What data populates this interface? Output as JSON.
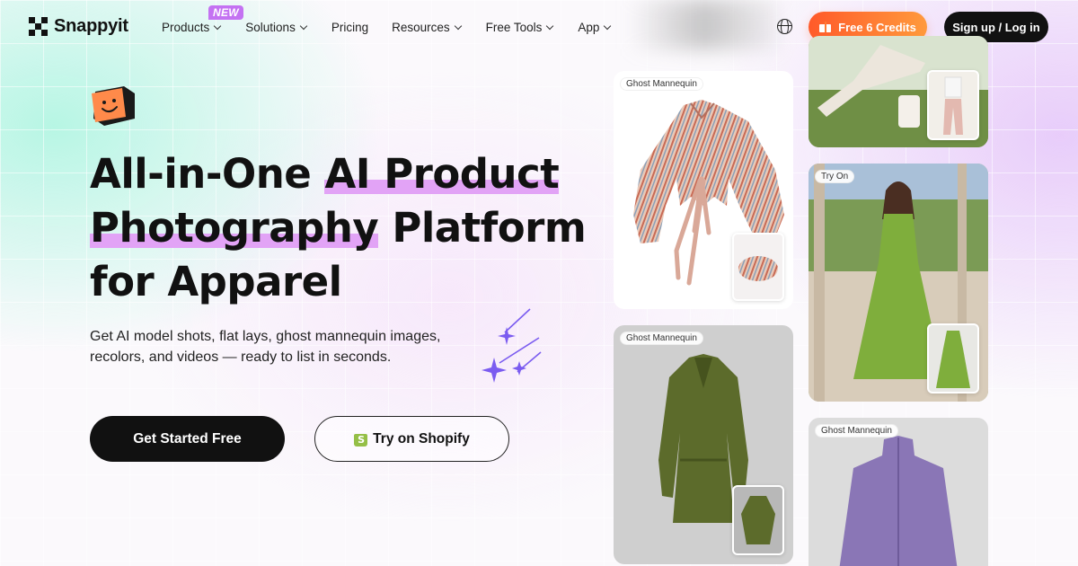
{
  "brand": {
    "name": "Snappyit"
  },
  "nav": {
    "items": [
      {
        "label": "Products",
        "has_dropdown": true,
        "badge": "NEW"
      },
      {
        "label": "Solutions",
        "has_dropdown": true
      },
      {
        "label": "Pricing",
        "has_dropdown": false
      },
      {
        "label": "Resources",
        "has_dropdown": true
      },
      {
        "label": "Free Tools",
        "has_dropdown": true
      },
      {
        "label": "App",
        "has_dropdown": true
      }
    ],
    "credits_button": "Free 6 Credits",
    "signup_button": "Sign up / Log in"
  },
  "hero": {
    "headline": {
      "line1_plain": "All-in-One ",
      "line1_highlight": "AI Product",
      "line2_highlight": "Photography",
      "line2_plain": " Platform",
      "line3": "for Apparel"
    },
    "subtext": "Get AI model shots, flat lays, ghost mannequin images, recolors, and videos — ready to list in seconds.",
    "cta_primary": "Get Started Free",
    "cta_secondary": "Try on Shopify"
  },
  "gallery": {
    "cards": [
      {
        "tag": "Ghost Mannequin",
        "subject": "striped puff-sleeve blouse"
      },
      {
        "tag": "Ghost Mannequin",
        "subject": "green velvet dress"
      },
      {
        "tag": "",
        "subject": "model in white trousers on lawn"
      },
      {
        "tag": "Try On",
        "subject": "model in green maxi dress"
      },
      {
        "tag": "Ghost Mannequin",
        "subject": "purple zip jacket"
      }
    ]
  },
  "colors": {
    "accent_highlight": "#e2a3f6",
    "new_badge": "#c472f2",
    "credits_gradient_start": "#ff5a2a",
    "credits_gradient_end": "#ff9a3c",
    "primary_dark": "#111111",
    "sparkle": "#7b5cf0"
  }
}
